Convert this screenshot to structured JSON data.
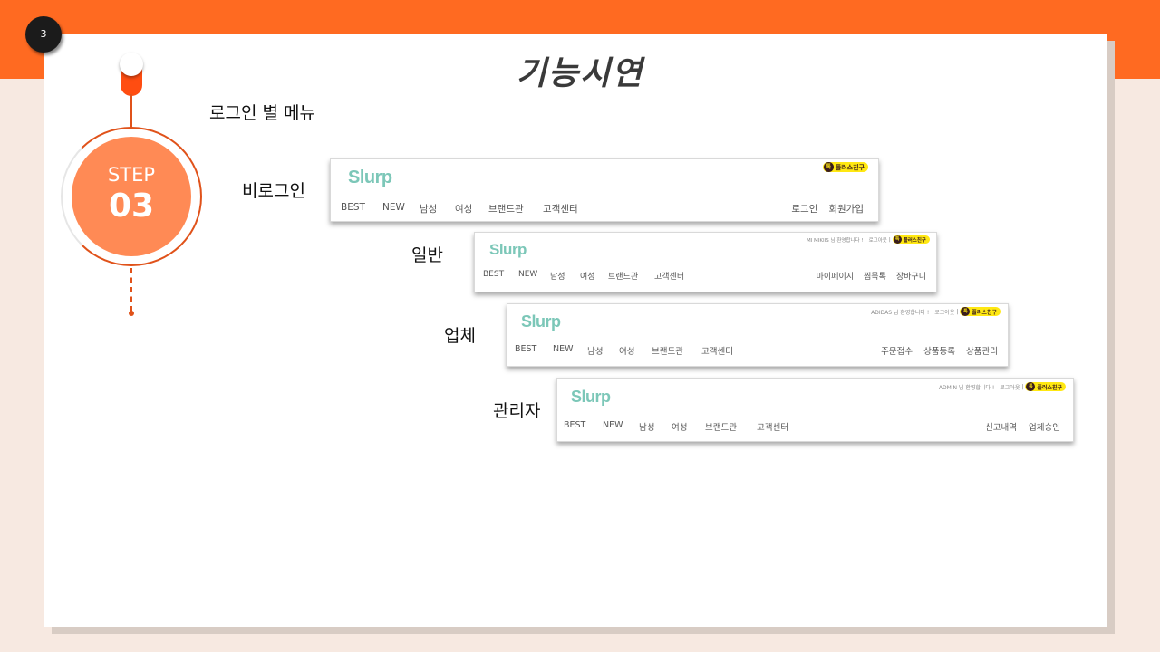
{
  "slide": {
    "number": "3",
    "title": "기능시연",
    "subtitle": "로그인 별 메뉴"
  },
  "step": {
    "label": "STEP",
    "number": "03"
  },
  "accent_colors": {
    "orange": "#ff6a21",
    "step_fill": "#ff8a55",
    "logo": "#7cc7b8",
    "kakao": "#ffe812"
  },
  "rows": [
    {
      "label": "비로그인",
      "logo": "Slurp",
      "menu": [
        "BEST",
        "NEW",
        "남성",
        "여성",
        "브랜드관",
        "고객센터"
      ],
      "right_menu": [
        "로그인",
        "회원가입"
      ],
      "welcome": "",
      "logout": "",
      "kakao": "플러스친구"
    },
    {
      "label": "일반",
      "logo": "Slurp",
      "menu": [
        "BEST",
        "NEW",
        "남성",
        "여성",
        "브랜드관",
        "고객센터"
      ],
      "right_menu": [
        "마이페이지",
        "찜목록",
        "장바구니"
      ],
      "welcome": "MI MIKIIS 님 환영합니다 !",
      "logout": "로그아웃",
      "kakao": "플러스친구"
    },
    {
      "label": "업체",
      "logo": "Slurp",
      "menu": [
        "BEST",
        "NEW",
        "남성",
        "여성",
        "브랜드관",
        "고객센터"
      ],
      "right_menu": [
        "주문접수",
        "상품등록",
        "상품관리"
      ],
      "welcome": "ADIDAS 님 환영합니다 !",
      "logout": "로그아웃",
      "kakao": "플러스친구"
    },
    {
      "label": "관리자",
      "logo": "Slurp",
      "menu": [
        "BEST",
        "NEW",
        "남성",
        "여성",
        "브랜드관",
        "고객센터"
      ],
      "right_menu": [
        "신고내역",
        "업체승인"
      ],
      "welcome": "ADMIN 님 환영합니다 !",
      "logout": "로그아웃",
      "kakao": "플러스친구"
    }
  ]
}
